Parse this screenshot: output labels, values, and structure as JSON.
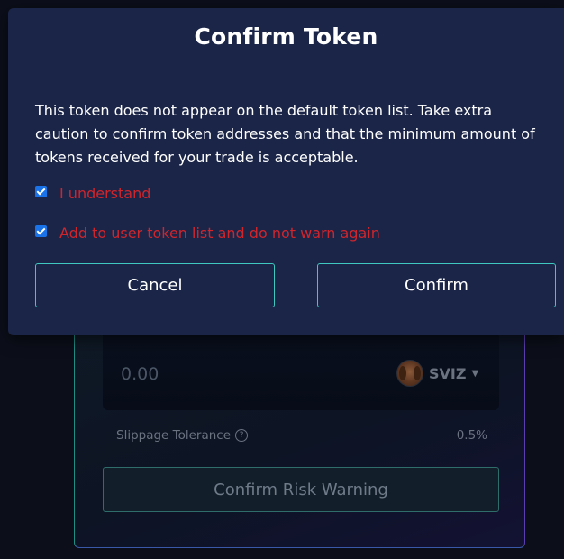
{
  "modal": {
    "title": "Confirm Token",
    "warning": "This token does not appear on the default token list. Take extra\ncaution to confirm token addresses and that the minimum amount of\ntokens received for your trade is acceptable.",
    "checkbox_understand": {
      "label": "I understand",
      "checked": true
    },
    "checkbox_add_list": {
      "label": "Add to user token list and do not warn again",
      "checked": true
    },
    "cancel_label": "Cancel",
    "confirm_label": "Confirm"
  },
  "swap_card": {
    "amount_placeholder": "0.00",
    "token_symbol": "SVIZ",
    "slippage_label": "Slippage Tolerance",
    "slippage_value": "0.5%",
    "risk_button_label": "Confirm Risk Warning"
  },
  "colors": {
    "modal_bg": "#1b2548",
    "accent_border": "#3fc8c0",
    "warning_red": "#d1252c",
    "checkbox_blue": "#1a73e8"
  },
  "icons": {
    "help": "question-circle-icon",
    "dropdown": "caret-down-icon",
    "token": "token-avatar-icon"
  }
}
